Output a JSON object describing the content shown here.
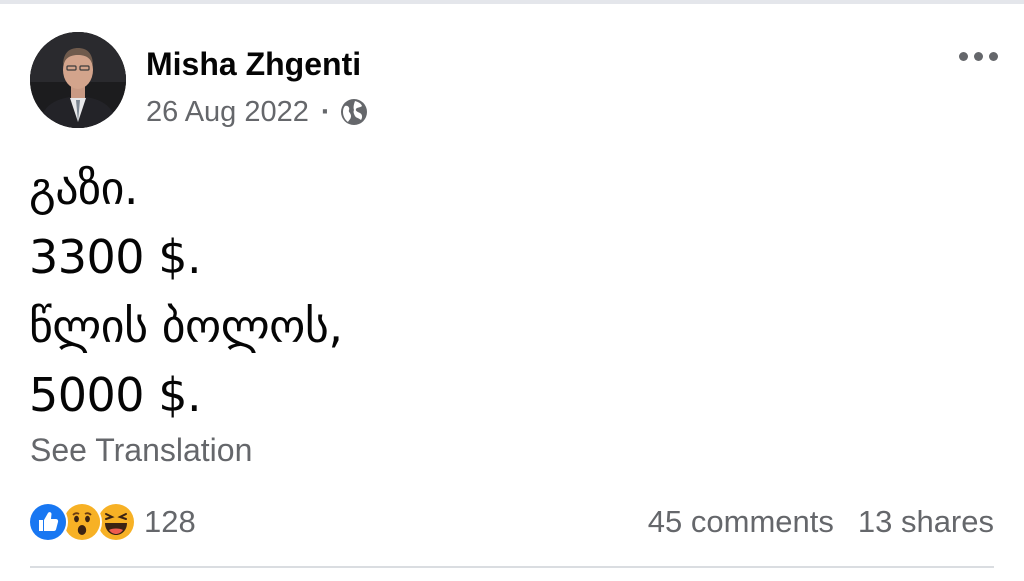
{
  "post": {
    "author": {
      "name": "Misha Zhgenti"
    },
    "date": "26 Aug 2022",
    "separator": "·",
    "audience_icon": "globe-icon",
    "more_icon": "more-horizontal-icon",
    "text_lines": [
      "გაზი.",
      "3300 $.",
      "წლის ბოლოს,",
      "5000 $."
    ],
    "see_translation": "See Translation"
  },
  "engagement": {
    "reaction_icons": [
      "like-icon",
      "wow-icon",
      "haha-icon"
    ],
    "reaction_count": "128",
    "comments": "45 comments",
    "shares": "13 shares"
  },
  "colors": {
    "text_primary": "#050505",
    "text_secondary": "#65676b",
    "like_blue": "#1877f2",
    "emoji_yellow": "#f7b125",
    "divider": "#dadde1"
  }
}
